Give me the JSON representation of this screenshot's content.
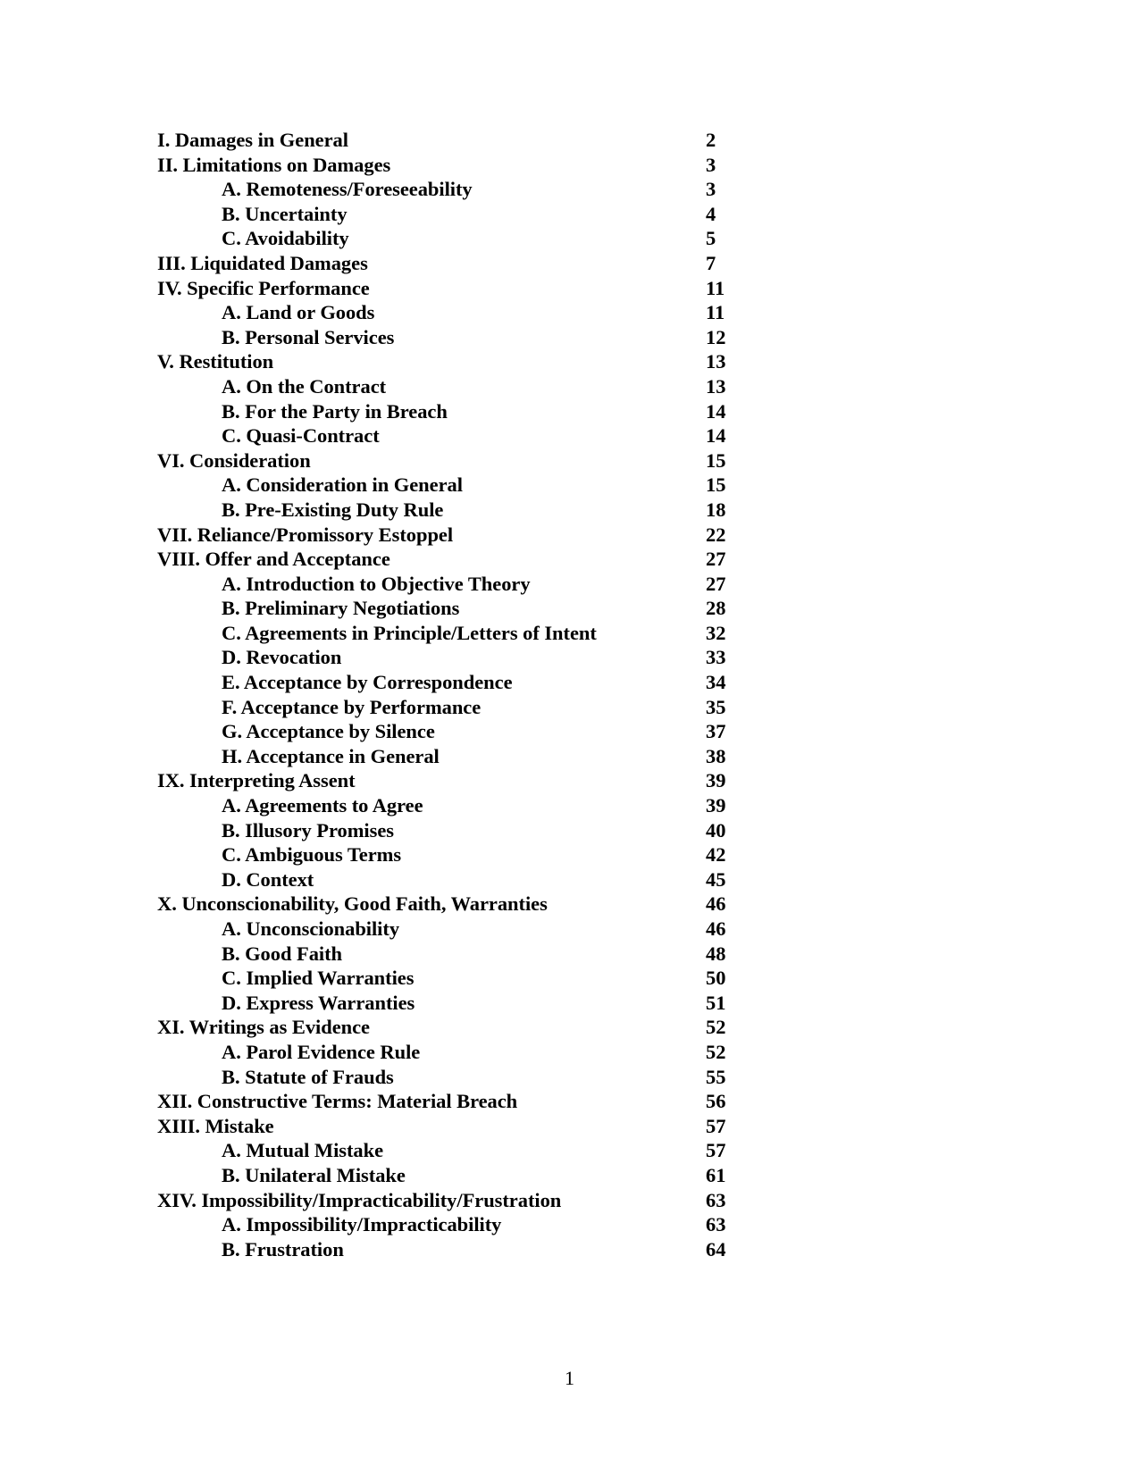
{
  "document": {
    "footer_page_number": "1"
  },
  "toc": {
    "entries": [
      {
        "level": "main",
        "label": "I. Damages in General",
        "page": "2"
      },
      {
        "level": "main",
        "label": "II. Limitations on Damages",
        "page": "3"
      },
      {
        "level": "sub",
        "label": "A. Remoteness/Foreseeability",
        "page": "3"
      },
      {
        "level": "sub",
        "label": "B. Uncertainty",
        "page": "4"
      },
      {
        "level": "sub",
        "label": "C. Avoidability",
        "page": "5"
      },
      {
        "level": "main",
        "label": "III. Liquidated Damages",
        "page": "7"
      },
      {
        "level": "main",
        "label": "IV. Specific Performance",
        "page": "11"
      },
      {
        "level": "sub",
        "label": "A. Land or Goods",
        "page": "11"
      },
      {
        "level": "sub",
        "label": "B. Personal Services",
        "page": "12"
      },
      {
        "level": "main",
        "label": "V. Restitution",
        "page": "13"
      },
      {
        "level": "sub",
        "label": "A. On the Contract",
        "page": "13"
      },
      {
        "level": "sub",
        "label": "B. For the Party in Breach",
        "page": "14"
      },
      {
        "level": "sub",
        "label": "C. Quasi-Contract",
        "page": "14"
      },
      {
        "level": "main",
        "label": "VI. Consideration",
        "page": "15"
      },
      {
        "level": "sub",
        "label": "A. Consideration in General",
        "page": "15"
      },
      {
        "level": "sub",
        "label": "B. Pre-Existing Duty Rule",
        "page": "18"
      },
      {
        "level": "main",
        "label": "VII. Reliance/Promissory Estoppel",
        "page": "22"
      },
      {
        "level": "main",
        "label": "VIII. Offer and Acceptance",
        "page": "27"
      },
      {
        "level": "sub",
        "label": "A. Introduction to Objective Theory",
        "page": "27"
      },
      {
        "level": "sub",
        "label": "B. Preliminary Negotiations",
        "page": "28"
      },
      {
        "level": "sub",
        "label": "C. Agreements in Principle/Letters of Intent",
        "page": "32"
      },
      {
        "level": "sub",
        "label": "D. Revocation",
        "page": "33"
      },
      {
        "level": "sub",
        "label": "E. Acceptance by Correspondence",
        "page": "34"
      },
      {
        "level": "sub",
        "label": "F. Acceptance by Performance",
        "page": "35"
      },
      {
        "level": "sub",
        "label": "G. Acceptance by Silence",
        "page": "37"
      },
      {
        "level": "sub",
        "label": "H. Acceptance in General",
        "page": "38"
      },
      {
        "level": "main",
        "label": "IX. Interpreting Assent",
        "page": "39"
      },
      {
        "level": "sub",
        "label": "A. Agreements to Agree",
        "page": "39"
      },
      {
        "level": "sub",
        "label": "B. Illusory Promises",
        "page": "40"
      },
      {
        "level": "sub",
        "label": "C. Ambiguous Terms",
        "page": "42"
      },
      {
        "level": "sub",
        "label": "D. Context",
        "page": "45"
      },
      {
        "level": "main",
        "label": "X. Unconscionability, Good Faith, Warranties",
        "page": "46"
      },
      {
        "level": "sub",
        "label": "A. Unconscionability",
        "page": "46"
      },
      {
        "level": "sub",
        "label": "B. Good Faith",
        "page": "48"
      },
      {
        "level": "sub",
        "label": "C. Implied Warranties",
        "page": "50"
      },
      {
        "level": "sub",
        "label": "D. Express Warranties",
        "page": "51"
      },
      {
        "level": "main",
        "label": "XI. Writings as Evidence",
        "page": "52"
      },
      {
        "level": "sub",
        "label": "A. Parol Evidence Rule",
        "page": "52"
      },
      {
        "level": "sub",
        "label": "B. Statute of Frauds",
        "page": "55"
      },
      {
        "level": "main",
        "label": "XII. Constructive Terms: Material Breach",
        "page": "56"
      },
      {
        "level": "main",
        "label": "XIII. Mistake",
        "page": "57"
      },
      {
        "level": "sub",
        "label": "A. Mutual Mistake",
        "page": "57"
      },
      {
        "level": "sub",
        "label": "B. Unilateral Mistake",
        "page": "61"
      },
      {
        "level": "main",
        "label": "XIV. Impossibility/Impracticability/Frustration",
        "page": "63"
      },
      {
        "level": "sub",
        "label": "A. Impossibility/Impracticability",
        "page": "63"
      },
      {
        "level": "sub",
        "label": "B. Frustration",
        "page": "64"
      }
    ]
  }
}
